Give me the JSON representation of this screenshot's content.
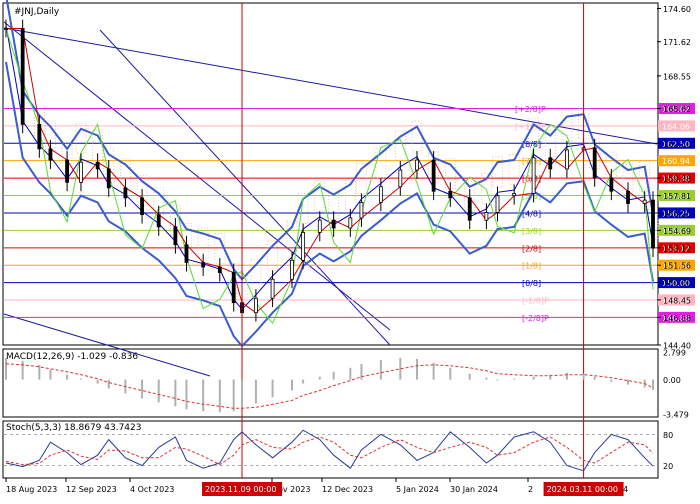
{
  "header": {
    "symbol_label": "#JNJ,Daily"
  },
  "price_axis": {
    "ticks": [
      "174.60",
      "171.62",
      "168.55",
      "165.62",
      "162.50",
      "159.38",
      "157.81",
      "156.25",
      "154.69",
      "153.12",
      "151.56",
      "150.00",
      "148.45",
      "146.88",
      "144.40"
    ]
  },
  "murrey_lines": [
    {
      "label": "[+2/8]P",
      "value": 165.62,
      "color": "#e020e0"
    },
    {
      "label": "[+1/8]P",
      "value": 164.06,
      "color": "#ffb6c1"
    },
    {
      "label": "[8/8]",
      "value": 162.5,
      "color": "#0000c0"
    },
    {
      "label": "[7/8]",
      "value": 160.94,
      "color": "#ffa500"
    },
    {
      "label": "[6/8]",
      "value": 159.38,
      "color": "#e00000"
    },
    {
      "label": "[5/8]",
      "value": 157.81,
      "color": "#9acd32"
    },
    {
      "label": "[4/8]",
      "value": 156.25,
      "color": "#0000c0"
    },
    {
      "label": "[3/8]",
      "value": 154.69,
      "color": "#9acd32"
    },
    {
      "label": "[2/8]",
      "value": 153.12,
      "color": "#e00000"
    },
    {
      "label": "[1/8]",
      "value": 151.56,
      "color": "#ffa500"
    },
    {
      "label": "[0/8]",
      "value": 150.0,
      "color": "#0000c0"
    },
    {
      "label": "[-1/8]P",
      "value": 148.44,
      "color": "#ffb6c1"
    },
    {
      "label": "[-2/8]P",
      "value": 146.88,
      "color": "#e020e0"
    }
  ],
  "right_price_tags": [
    {
      "text": "165.62",
      "value": 165.62,
      "bg": "#e020e0",
      "fg": "#ffffff"
    },
    {
      "text": "164.06",
      "value": 164.06,
      "bg": "#ffb6c1",
      "fg": "#ffffff"
    },
    {
      "text": "162.50",
      "value": 162.5,
      "bg": "#0000c0",
      "fg": "#ffffff"
    },
    {
      "text": "160.94",
      "value": 160.94,
      "bg": "#ffa500",
      "fg": "#ffffff"
    },
    {
      "text": "159.38",
      "value": 159.38,
      "bg": "#e00000",
      "fg": "#ffffff"
    },
    {
      "text": "157.81",
      "value": 157.81,
      "bg": "#9acd32",
      "fg": "#ffffff"
    },
    {
      "text": "156.25",
      "value": 156.25,
      "bg": "#0000c0",
      "fg": "#ffffff"
    },
    {
      "text": "154.69",
      "value": 154.69,
      "bg": "#9acd32",
      "fg": "#ffffff"
    },
    {
      "text": "153.12",
      "value": 153.12,
      "bg": "#e00000",
      "fg": "#ffffff"
    },
    {
      "text": "151.56",
      "value": 151.56,
      "bg": "#ffa500",
      "fg": "#ffffff"
    },
    {
      "text": "150.00",
      "value": 150.0,
      "bg": "#0000c0",
      "fg": "#ffffff"
    },
    {
      "text": "148.44",
      "value": 148.44,
      "bg": "#ffb6c1",
      "fg": "#ffffff"
    },
    {
      "text": "146.88",
      "value": 146.88,
      "bg": "#e020e0",
      "fg": "#ffffff"
    }
  ],
  "macd": {
    "label": "MACD(12,26,9) -1.029 -0.836",
    "ticks": [
      "2.799",
      "0.00",
      "-3.479"
    ]
  },
  "stoch": {
    "label": "Stoch(5,3,3) 18.8679 43.7423",
    "ticks": [
      "80",
      "20"
    ]
  },
  "time_axis": {
    "labels": [
      "18 Aug 2023",
      "12 Sep 2023",
      "4 Oct 2023",
      "Nov 2023",
      "12 Dec 2023",
      "5 Jan 2024",
      "30 Jan 2024",
      "2"
    ],
    "partial_label": "r 2024",
    "markers": [
      "2023.11.09 00:00",
      "2024.03.11 00:00"
    ]
  },
  "colors": {
    "price": "#000000",
    "bollinger": "#3a5ccc",
    "ema": "#cc0000",
    "ema_alt": "#0000c0",
    "momentum": "#55dd33",
    "ichimoku_cloud": "#e8a070",
    "channel": "#1a1aa0",
    "vline": "#cc0000",
    "macd_signal": "#dd3333",
    "macd_hist": "#b0b0b0",
    "stoch_main": "#2a3a9a",
    "stoch_signal": "#dd3333",
    "tag_text": "#ffffff"
  },
  "chart_data": {
    "type": "line",
    "title": "#JNJ,Daily",
    "x": [
      "2023-08-16",
      "2023-08-22",
      "2023-08-28",
      "2023-09-01",
      "2023-09-07",
      "2023-09-12",
      "2023-09-18",
      "2023-09-22",
      "2023-09-28",
      "2023-10-04",
      "2023-10-10",
      "2023-10-16",
      "2023-10-20",
      "2023-10-26",
      "2023-11-01",
      "2023-11-06",
      "2023-11-09",
      "2023-11-14",
      "2023-11-20",
      "2023-11-27",
      "2023-12-01",
      "2023-12-07",
      "2023-12-12",
      "2023-12-18",
      "2023-12-22",
      "2023-12-29",
      "2024-01-05",
      "2024-01-11",
      "2024-01-17",
      "2024-01-23",
      "2024-01-30",
      "2024-02-05",
      "2024-02-09",
      "2024-02-15",
      "2024-02-22",
      "2024-02-28",
      "2024-03-05",
      "2024-03-11",
      "2024-03-15",
      "2024-03-21",
      "2024-03-27",
      "2024-04-02",
      "2024-04-05"
    ],
    "series": [
      {
        "values": [
          172.8,
          164.2,
          162.0,
          161.0,
          159.0,
          160.8,
          160.2,
          158.5,
          157.6,
          156.1,
          155.0,
          153.4,
          151.8,
          151.4,
          150.9,
          148.2,
          147.3,
          148.6,
          150.3,
          152.0,
          154.5,
          155.6,
          154.9,
          155.8,
          157.2,
          158.6,
          160.1,
          161.0,
          158.2,
          157.6,
          155.6,
          156.3,
          157.8,
          158.0,
          161.2,
          160.2,
          161.9,
          162.1,
          159.4,
          158.2,
          157.1,
          157.4,
          153.1
        ]
      }
    ],
    "ylim": [
      144.4,
      175.0
    ],
    "grid": false,
    "vertical_markers": [
      "2023-11-09",
      "2024-03-11"
    ],
    "macd": {
      "values": [
        2.2,
        1.9,
        1.5,
        1.0,
        0.5,
        0.1,
        -0.4,
        -0.9,
        -1.4,
        -1.9,
        -2.3,
        -2.7,
        -3.0,
        -3.2,
        -3.3,
        -3.2,
        -2.9,
        -2.4,
        -1.8,
        -1.1,
        -0.4,
        0.3,
        0.8,
        1.2,
        1.6,
        2.0,
        2.2,
        2.1,
        1.7,
        1.2,
        0.6,
        0.2,
        -0.1,
        0.1,
        0.3,
        0.5,
        0.7,
        0.6,
        0.3,
        -0.2,
        -0.5,
        -0.8,
        -1.029
      ],
      "signal": [
        1.6,
        1.5,
        1.3,
        1.1,
        0.8,
        0.5,
        0.1,
        -0.3,
        -0.7,
        -1.1,
        -1.5,
        -1.9,
        -2.2,
        -2.5,
        -2.7,
        -2.9,
        -2.9,
        -2.8,
        -2.5,
        -2.1,
        -1.6,
        -1.1,
        -0.6,
        -0.1,
        0.3,
        0.7,
        1.1,
        1.4,
        1.5,
        1.4,
        1.2,
        0.9,
        0.6,
        0.5,
        0.4,
        0.4,
        0.5,
        0.5,
        0.4,
        0.2,
        -0.1,
        -0.4,
        -0.836
      ],
      "ylim": [
        -3.479,
        2.799
      ]
    },
    "stochastic": {
      "k": [
        25,
        18,
        30,
        65,
        45,
        22,
        40,
        70,
        35,
        20,
        55,
        75,
        30,
        15,
        25,
        70,
        85,
        60,
        35,
        65,
        88,
        70,
        40,
        15,
        50,
        80,
        60,
        30,
        45,
        85,
        55,
        25,
        40,
        75,
        85,
        65,
        20,
        10,
        45,
        80,
        70,
        35,
        18.8679
      ],
      "d": [
        28,
        22,
        24,
        40,
        50,
        38,
        32,
        50,
        48,
        35,
        35,
        55,
        52,
        38,
        22,
        40,
        60,
        70,
        55,
        52,
        65,
        75,
        65,
        40,
        35,
        55,
        70,
        55,
        45,
        55,
        65,
        55,
        40,
        45,
        65,
        75,
        55,
        30,
        25,
        45,
        65,
        60,
        43.7423
      ],
      "ylim": [
        0,
        100
      ],
      "levels": [
        80,
        20
      ]
    }
  }
}
